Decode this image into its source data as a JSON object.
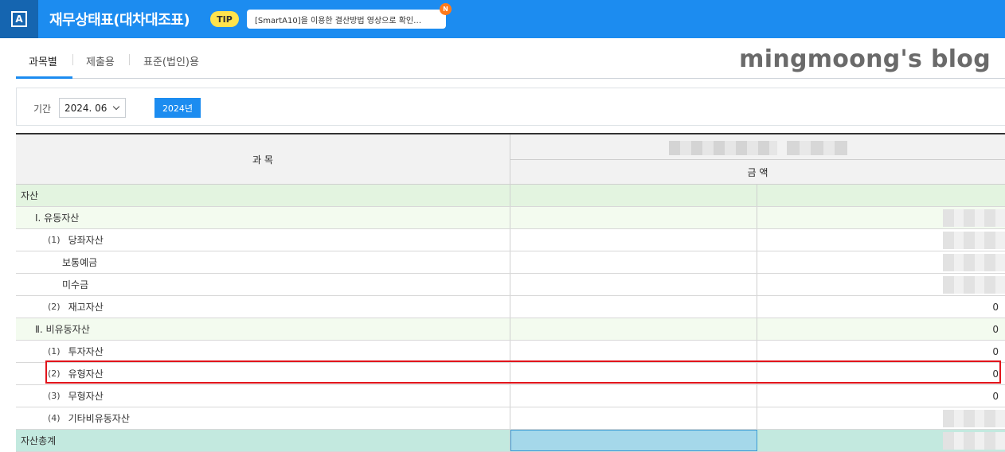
{
  "header": {
    "app_icon_letter": "A",
    "title": "재무상태표(대차대조표)",
    "tip_label": "TIP",
    "tip_text": "[SmartA10]을 이용한 결산방법 영상으로 확인…",
    "new_badge": "N"
  },
  "tabs": [
    {
      "label": "과목별",
      "active": true
    },
    {
      "label": "제출용",
      "active": false
    },
    {
      "label": "표준(법인)용",
      "active": false
    }
  ],
  "watermark": "mingmoong's blog",
  "filter": {
    "period_label": "기간",
    "period_value": "2024. 06",
    "year_button": "2024년"
  },
  "table": {
    "header_subject": "과 목",
    "header_amount": "금 액",
    "rows": [
      {
        "num": "",
        "label": "자산",
        "value": ""
      },
      {
        "num": "",
        "label": "Ⅰ. 유동자산",
        "value": ""
      },
      {
        "num": "(1)",
        "label": "당좌자산",
        "value": ""
      },
      {
        "num": "",
        "label": "보통예금",
        "value": ""
      },
      {
        "num": "",
        "label": "미수금",
        "value": ""
      },
      {
        "num": "(2)",
        "label": "재고자산",
        "value": "0"
      },
      {
        "num": "",
        "label": "Ⅱ. 비유동자산",
        "value": "0"
      },
      {
        "num": "(1)",
        "label": "투자자산",
        "value": "0"
      },
      {
        "num": "(2)",
        "label": "유형자산",
        "value": "0"
      },
      {
        "num": "(3)",
        "label": "무형자산",
        "value": "0"
      },
      {
        "num": "(4)",
        "label": "기타비유동자산",
        "value": ""
      },
      {
        "num": "",
        "label": "자산총계",
        "value": ""
      }
    ]
  },
  "colors": {
    "accent": "#1c8cf0",
    "highlight": "#e1141b"
  }
}
